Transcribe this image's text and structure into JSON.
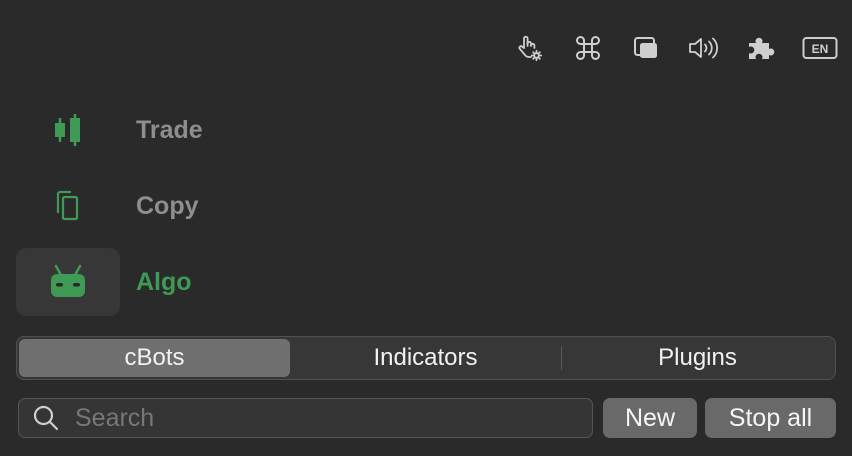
{
  "toolbar": {
    "icons": [
      "touch-settings-icon",
      "command-icon",
      "windows-icon",
      "volume-icon",
      "puzzle-icon",
      "language-icon"
    ],
    "language": "EN"
  },
  "nav": {
    "items": [
      {
        "label": "Trade",
        "icon": "candlestick-icon",
        "active": false
      },
      {
        "label": "Copy",
        "icon": "copy-icon",
        "active": false
      },
      {
        "label": "Algo",
        "icon": "robot-icon",
        "active": true
      }
    ]
  },
  "tabs": [
    {
      "label": "cBots",
      "active": true
    },
    {
      "label": "Indicators",
      "active": false
    },
    {
      "label": "Plugins",
      "active": false
    }
  ],
  "search": {
    "placeholder": "Search",
    "value": ""
  },
  "actions": {
    "new_label": "New",
    "stop_all_label": "Stop all"
  },
  "colors": {
    "accent": "#3f9a55",
    "background": "#2a2a2a"
  }
}
